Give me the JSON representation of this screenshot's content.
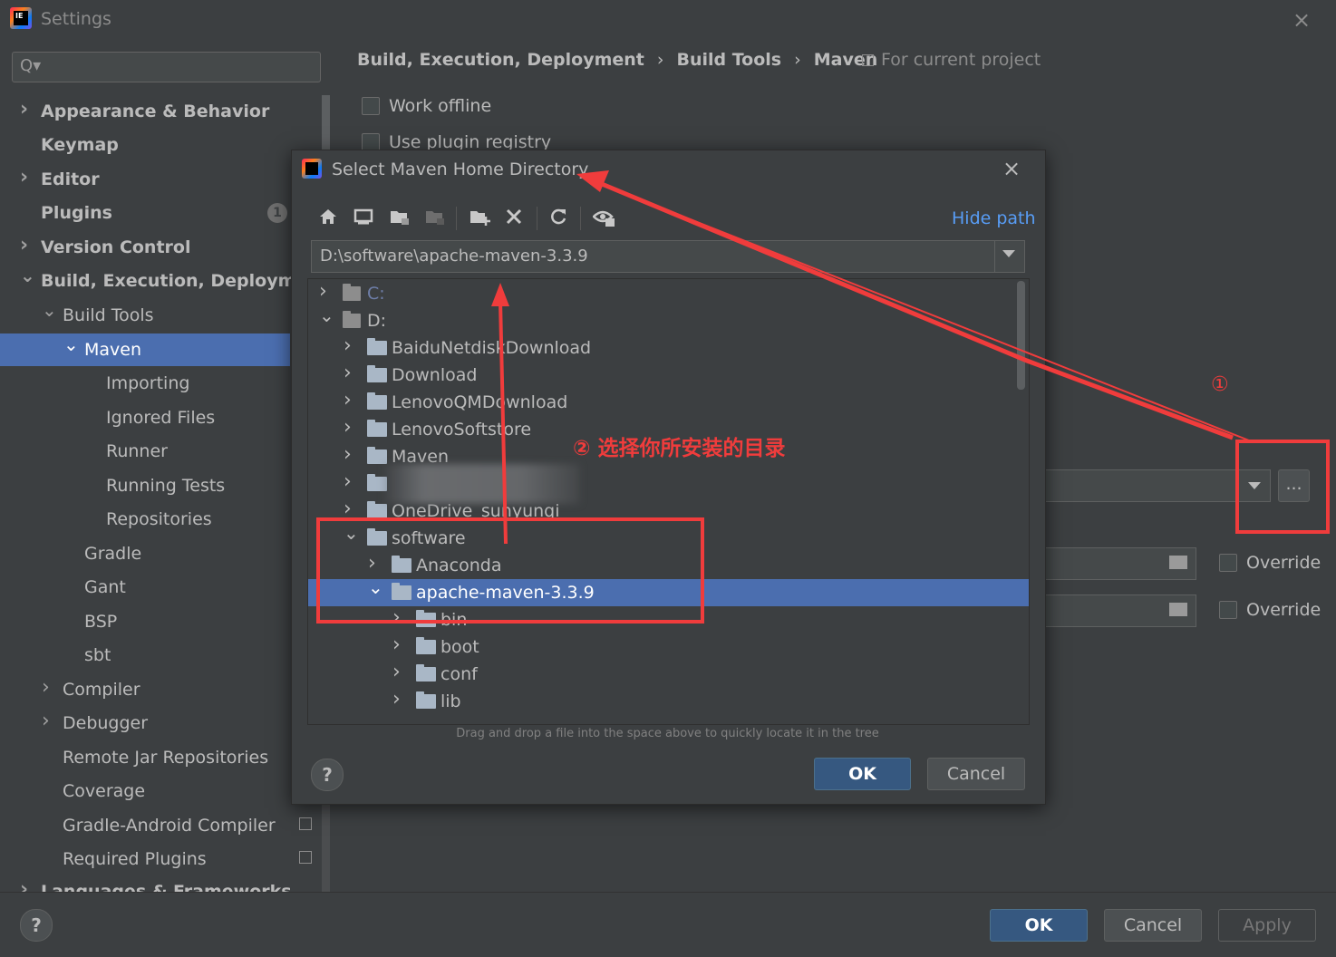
{
  "window": {
    "title": "Settings",
    "close_icon": "×"
  },
  "search": {
    "placeholder": "",
    "icon": "Q▾"
  },
  "sidebar": {
    "items": [
      {
        "label": "Appearance & Behavior"
      },
      {
        "label": "Keymap"
      },
      {
        "label": "Editor"
      },
      {
        "label": "Plugins",
        "badge": "1"
      },
      {
        "label": "Version Control"
      },
      {
        "label": "Build, Execution, Deployment"
      },
      {
        "label": "Build Tools"
      },
      {
        "label": "Maven"
      },
      {
        "label": "Importing"
      },
      {
        "label": "Ignored Files"
      },
      {
        "label": "Runner"
      },
      {
        "label": "Running Tests"
      },
      {
        "label": "Repositories"
      },
      {
        "label": "Gradle"
      },
      {
        "label": "Gant"
      },
      {
        "label": "BSP"
      },
      {
        "label": "sbt"
      },
      {
        "label": "Compiler"
      },
      {
        "label": "Debugger"
      },
      {
        "label": "Remote Jar Repositories"
      },
      {
        "label": "Coverage"
      },
      {
        "label": "Gradle-Android Compiler"
      },
      {
        "label": "Required Plugins"
      },
      {
        "label": "Languages & Frameworks"
      }
    ]
  },
  "main": {
    "breadcrumb": [
      "Build, Execution, Deployment",
      "Build Tools",
      "Maven"
    ],
    "breadcrumb_sep": "›",
    "scope": "For current project",
    "work_offline": "Work offline",
    "use_plugin_registry": "Use plugin registry",
    "override_1": "Override",
    "override_2": "Override",
    "browse_button": "..."
  },
  "footer": {
    "ok": "OK",
    "cancel": "Cancel",
    "apply": "Apply",
    "help": "?"
  },
  "dialog": {
    "title": "Select Maven Home Directory",
    "hide_path": "Hide path",
    "path_value": "D:\\software\\apache-maven-3.3.9",
    "drag_hint": "Drag and drop a file into the space above to quickly locate it in the tree",
    "ok": "OK",
    "cancel": "Cancel",
    "help": "?",
    "toolbar_icons": [
      "home-icon",
      "desktop-icon",
      "project-folder-icon",
      "module-folder-icon",
      "new-folder-icon",
      "delete-icon",
      "refresh-icon",
      "show-hidden-icon"
    ],
    "tree": [
      {
        "label": "C:",
        "level": 0,
        "expanded": false,
        "drive": true
      },
      {
        "label": "D:",
        "level": 0,
        "expanded": true,
        "drive": true
      },
      {
        "label": "BaiduNetdiskDownload",
        "level": 1,
        "expanded": false
      },
      {
        "label": "Download",
        "level": 1,
        "expanded": false
      },
      {
        "label": "LenovoQMDownload",
        "level": 1,
        "expanded": false
      },
      {
        "label": "LenovoSoftstore",
        "level": 1,
        "expanded": false
      },
      {
        "label": "Maven",
        "level": 1,
        "expanded": false
      },
      {
        "label": "",
        "level": 1,
        "expanded": false
      },
      {
        "label": "OneDrive_sunyunqi",
        "level": 1,
        "expanded": false
      },
      {
        "label": "software",
        "level": 1,
        "expanded": true
      },
      {
        "label": "Anaconda",
        "level": 2,
        "expanded": false
      },
      {
        "label": "apache-maven-3.3.9",
        "level": 2,
        "expanded": true,
        "selected": true
      },
      {
        "label": "bin",
        "level": 3,
        "expanded": false
      },
      {
        "label": "boot",
        "level": 3,
        "expanded": false
      },
      {
        "label": "conf",
        "level": 3,
        "expanded": false
      },
      {
        "label": "lib",
        "level": 3,
        "expanded": false
      }
    ]
  },
  "annotations": {
    "step1": "①",
    "step2": "② 选择你所安装的目录",
    "color": "#f03c3c"
  },
  "colors": {
    "background": "#3c3f41",
    "selection": "#4b6eaf",
    "link": "#589df6",
    "primary_button": "#365880"
  }
}
